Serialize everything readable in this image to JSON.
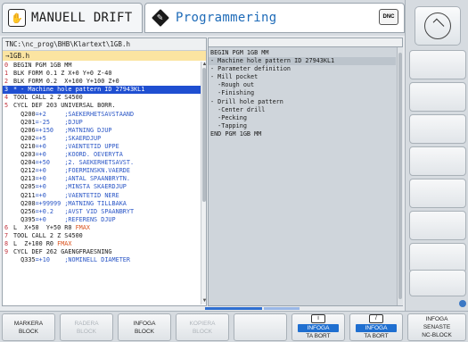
{
  "header": {
    "mode_manual": "MANUELL DRIFT",
    "mode_programming": "Programmering",
    "dnc_label": "DNC"
  },
  "editor": {
    "path": "TNC:\\nc_prog\\BHB\\Klartext\\1GB.h",
    "file_indicator": "→1GB.h",
    "lines": [
      {
        "num": "0",
        "text": "BEGIN PGM 1GB MM"
      },
      {
        "num": "1",
        "text": "BLK FORM 0.1 Z X+0 Y+0 Z-40"
      },
      {
        "num": "2",
        "text": "BLK FORM 0.2  X+100 Y+100 Z+0"
      },
      {
        "num": "3",
        "text": "* - Machine hole pattern ID 27943KL1",
        "selected": true
      },
      {
        "num": "4",
        "text": "TOOL CALL 2 Z S4500"
      },
      {
        "num": "5",
        "text": "CYCL DEF 203 UNIVERSAL BORR."
      },
      {
        "num": "",
        "text": "  Q200=+2     ;SAEKERHETSAVSTAAND"
      },
      {
        "num": "",
        "text": "  Q201=-25    ;DJUP"
      },
      {
        "num": "",
        "text": "  Q206=+150   ;MATNING DJUP"
      },
      {
        "num": "",
        "text": "  Q202=+5     ;SKAERDJUP"
      },
      {
        "num": "",
        "text": "  Q210=+0     ;VAENTETID UPPE"
      },
      {
        "num": "",
        "text": "  Q203=+0     ;KOORD. OEVERYTA"
      },
      {
        "num": "",
        "text": "  Q204=+50    ;2. SAEKERHETSAVST."
      },
      {
        "num": "",
        "text": "  Q212=+0     ;FOERMINSKN.VAERDE"
      },
      {
        "num": "",
        "text": "  Q213=+0     ;ANTAL SPAANBRYTN."
      },
      {
        "num": "",
        "text": "  Q205=+0     ;MINSTA SKAERDJUP"
      },
      {
        "num": "",
        "text": "  Q211=+0     ;VAENTETID NERE"
      },
      {
        "num": "",
        "text": "  Q208=+99999 ;MATNING TILLBAKA"
      },
      {
        "num": "",
        "text": "  Q256=+0.2   ;AVST VID SPAANBRYT"
      },
      {
        "num": "",
        "text": "  Q395=+0     ;REFERENS DJUP"
      },
      {
        "num": "6",
        "text": "L  X+50  Y+50 R0 FMAX"
      },
      {
        "num": "7",
        "text": "TOOL CALL 2 Z S4500"
      },
      {
        "num": "8",
        "text": "L  Z+100 R0 FMAX"
      },
      {
        "num": "9",
        "text": "CYCL DEF 262 GAENGFRAESNING"
      },
      {
        "num": "",
        "text": "  Q335=+10    ;NOMINELL DIAMETER"
      }
    ]
  },
  "structure": {
    "lines": [
      {
        "text": "BEGIN PGM 1GB MM"
      },
      {
        "text": "- Machine hole pattern ID 27943KL1",
        "hl": true
      },
      {
        "text": "- Parameter definition"
      },
      {
        "text": "- Mill pocket"
      },
      {
        "text": "  -Rough out"
      },
      {
        "text": "  -Finishing"
      },
      {
        "text": "- Drill hole pattern"
      },
      {
        "text": "  -Center drill"
      },
      {
        "text": "  -Pecking"
      },
      {
        "text": "  -Tapping"
      },
      {
        "text": "END PGM 1GB MM"
      }
    ]
  },
  "softkeys": {
    "mark_block": [
      "MARKERA",
      "BLOCK"
    ],
    "delete_block": [
      "RADERA",
      "BLOCK"
    ],
    "insert_block": [
      "INFOGA",
      "BLOCK"
    ],
    "copy_block": [
      "KOPIERA",
      "BLOCK"
    ],
    "insert_delete_1": [
      "INFOGA",
      "TA BORT"
    ],
    "insert_delete_2": [
      "INFOGA",
      "TA BORT"
    ],
    "insert_last": [
      "INFOGA",
      "SENASTE",
      "NC-BLOCK"
    ]
  }
}
